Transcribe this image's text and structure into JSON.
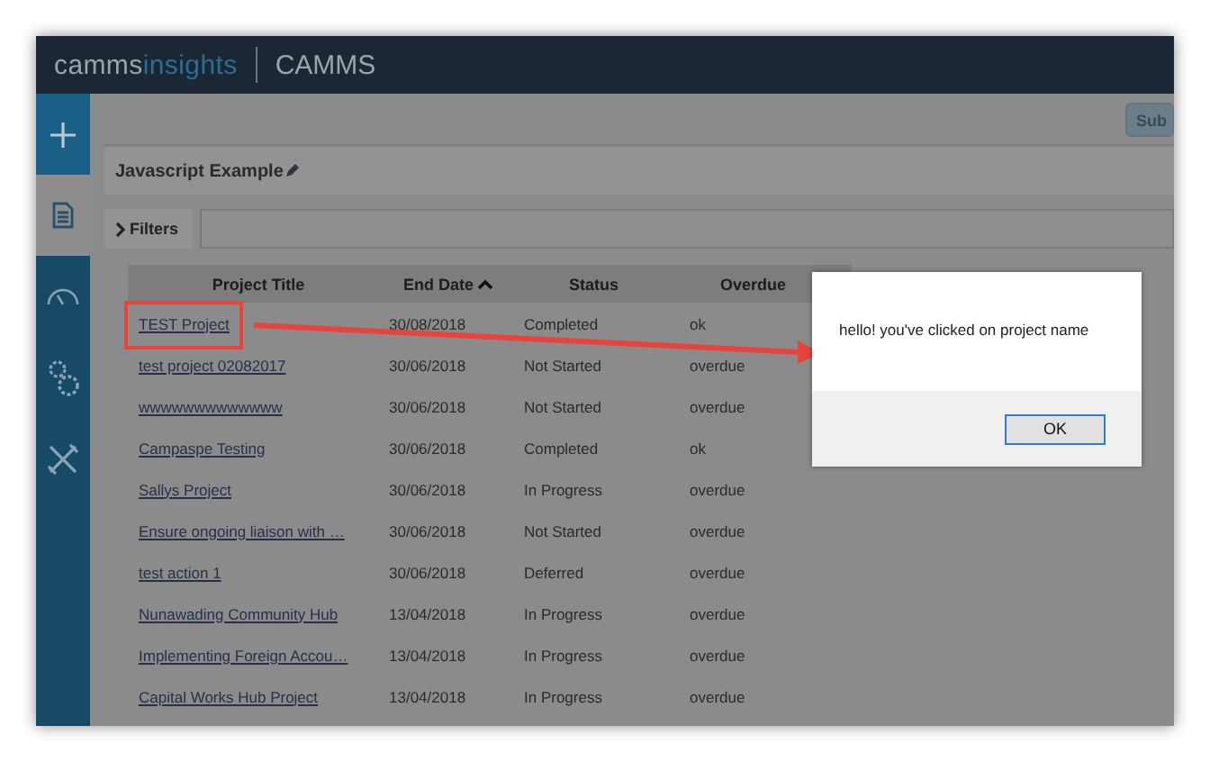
{
  "header": {
    "logo_main": "camms",
    "logo_accent": "insights",
    "product": "CAMMS"
  },
  "sidebar": {
    "items": [
      {
        "kind": "plus",
        "selected": false
      },
      {
        "kind": "document",
        "selected": true
      },
      {
        "kind": "gauge",
        "selected": false
      },
      {
        "kind": "gears",
        "selected": false
      },
      {
        "kind": "tools",
        "selected": false
      }
    ]
  },
  "toolbar": {
    "button": "Sub"
  },
  "page_title": "Javascript Example",
  "filters": {
    "label": "Filters"
  },
  "table": {
    "columns": [
      {
        "label": "Project Title",
        "sorted": false
      },
      {
        "label": "End Date",
        "sorted": true
      },
      {
        "label": "Status",
        "sorted": false
      },
      {
        "label": "Overdue",
        "sorted": false
      }
    ],
    "rows": [
      [
        "TEST Project",
        "30/08/2018",
        "Completed",
        "ok"
      ],
      [
        "test project 02082017",
        "30/06/2018",
        "Not Started",
        "overdue"
      ],
      [
        "wwwwwwwwwwwww",
        "30/06/2018",
        "Not Started",
        "overdue"
      ],
      [
        "Campaspe Testing",
        "30/06/2018",
        "Completed",
        "ok"
      ],
      [
        "Sallys Project",
        "30/06/2018",
        "In Progress",
        "overdue"
      ],
      [
        "Ensure ongoing liaison with …",
        "30/06/2018",
        "Not Started",
        "overdue"
      ],
      [
        "test action 1",
        "30/06/2018",
        "Deferred",
        "overdue"
      ],
      [
        "Nunawading Community Hub",
        "13/04/2018",
        "In Progress",
        "overdue"
      ],
      [
        "Implementing Foreign Accou…",
        "13/04/2018",
        "In Progress",
        "overdue"
      ],
      [
        "Capital Works Hub Project",
        "13/04/2018",
        "In Progress",
        "overdue"
      ]
    ]
  },
  "dialog": {
    "message": "hello! you've clicked on project name",
    "button": "OK"
  }
}
